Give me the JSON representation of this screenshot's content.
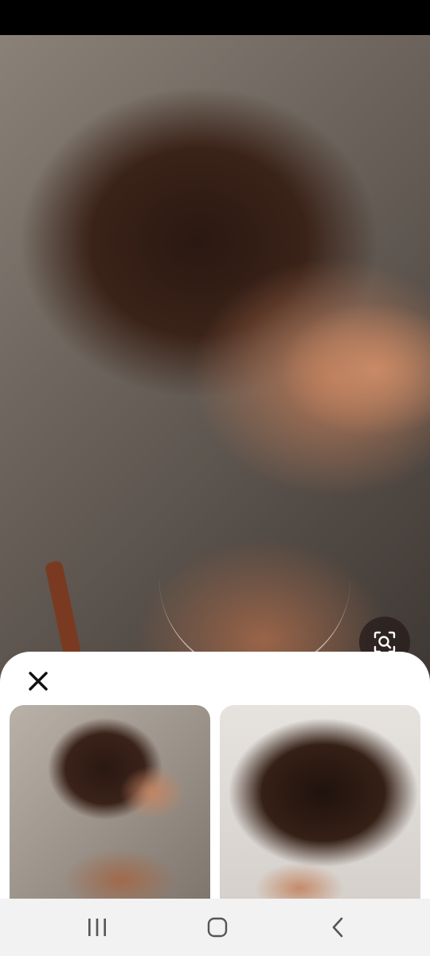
{
  "screen": {
    "type": "image-viewer",
    "hero_image": {
      "subject": "woman-with-short-curly-brown-hair"
    },
    "lens_button": {
      "icon": "image-search-icon"
    },
    "sheet": {
      "close_icon": "close-icon",
      "results": [
        {
          "subject": "woman-with-short-curly-hair-profile"
        },
        {
          "subject": "woman-with-messy-curly-bob"
        }
      ]
    },
    "navigation": {
      "recents_icon": "recents-icon",
      "home_icon": "home-icon",
      "back_icon": "back-icon"
    },
    "colors": {
      "sheet_background": "#ffffff",
      "nav_background": "#f2f2f2",
      "icon_dark": "#111111"
    }
  }
}
